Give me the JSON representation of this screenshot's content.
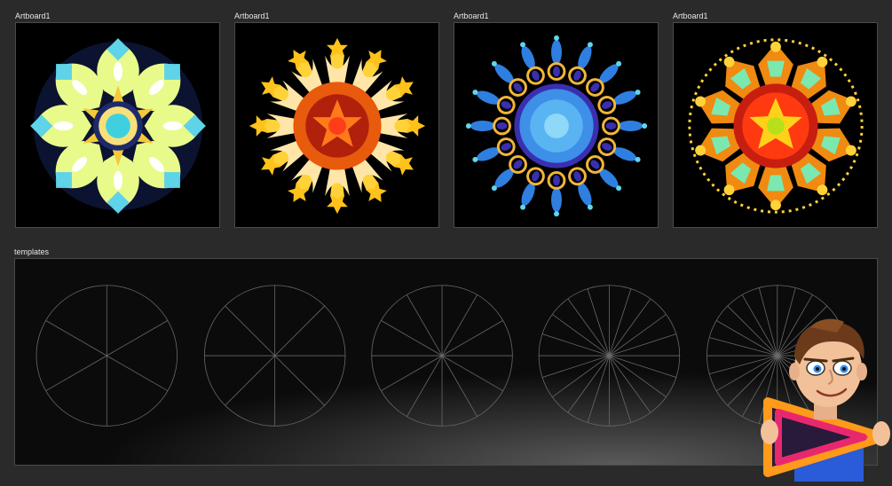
{
  "artboards": [
    {
      "label": "Artboard1",
      "theme": "yellow-green"
    },
    {
      "label": "Artboard1",
      "theme": "orange-fire"
    },
    {
      "label": "Artboard1",
      "theme": "blue"
    },
    {
      "label": "Artboard1",
      "theme": "red-yellow"
    }
  ],
  "templates": {
    "label": "templates",
    "segment_counts": [
      6,
      8,
      12,
      20,
      24
    ]
  },
  "colors": {
    "background": "#2a2a2a",
    "artboard_bg": "#000000",
    "template_lines": "#6a6a6a"
  },
  "mascot": {
    "icon": "mascot-character-icon"
  }
}
